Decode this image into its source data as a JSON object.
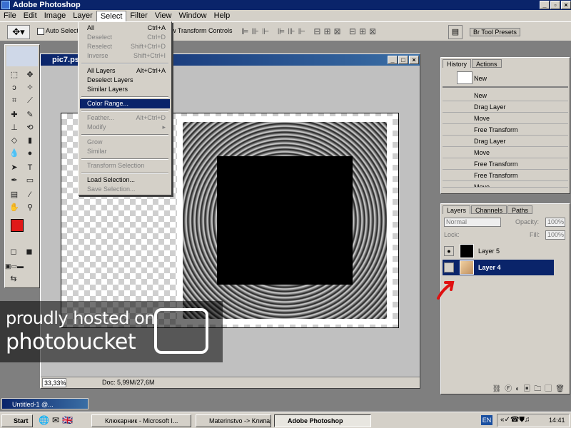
{
  "app": {
    "title": "Adobe Photoshop"
  },
  "menubar": [
    "File",
    "Edit",
    "Image",
    "Layer",
    "Select",
    "Filter",
    "View",
    "Window",
    "Help"
  ],
  "options": {
    "auto_select": "Auto Select L",
    "transform": "w Transform Controls",
    "tool_presets": "Tool Presets"
  },
  "document": {
    "title": "pic7.psd",
    "zoom": "33,33%",
    "doc_info": "Doc: 5,99M/27,6M"
  },
  "select_menu": [
    {
      "label": "All",
      "shortcut": "Ctrl+A",
      "enabled": true
    },
    {
      "label": "Deselect",
      "shortcut": "Ctrl+D",
      "enabled": false
    },
    {
      "label": "Reselect",
      "shortcut": "Shift+Ctrl+D",
      "enabled": false
    },
    {
      "label": "Inverse",
      "shortcut": "Shift+Ctrl+I",
      "enabled": false
    },
    {
      "label": "All Layers",
      "shortcut": "Alt+Ctrl+A",
      "enabled": true
    },
    {
      "label": "Deselect Layers",
      "shortcut": "",
      "enabled": true
    },
    {
      "label": "Similar Layers",
      "shortcut": "",
      "enabled": true
    },
    {
      "label": "Color Range...",
      "shortcut": "",
      "enabled": true,
      "highlighted": true
    },
    {
      "label": "Feather...",
      "shortcut": "Alt+Ctrl+D",
      "enabled": false
    },
    {
      "label": "Modify",
      "shortcut": "",
      "enabled": false
    },
    {
      "label": "Grow",
      "shortcut": "",
      "enabled": false
    },
    {
      "label": "Similar",
      "shortcut": "",
      "enabled": false
    },
    {
      "label": "Transform Selection",
      "shortcut": "",
      "enabled": false
    },
    {
      "label": "Load Selection...",
      "shortcut": "",
      "enabled": true
    },
    {
      "label": "Save Selection...",
      "shortcut": "",
      "enabled": false
    }
  ],
  "history": {
    "tabs": [
      "History",
      "Actions"
    ],
    "snapshot": "New",
    "items": [
      "New",
      "Drag Layer",
      "Move",
      "Free Transform",
      "Drag Layer",
      "Move",
      "Free Transform",
      "Free Transform",
      "Move"
    ]
  },
  "layers": {
    "tabs": [
      "Layers",
      "Channels",
      "Paths"
    ],
    "blend_mode": "Normal",
    "opacity_label": "Opacity:",
    "opacity": "100%",
    "lock_label": "Lock:",
    "fill_label": "Fill:",
    "fill": "100%",
    "items": [
      {
        "name": "Layer 5",
        "selected": false
      },
      {
        "name": "Layer 4",
        "selected": true
      }
    ]
  },
  "untitled_window": "Untitled-1 @...",
  "taskbar": {
    "start": "Start",
    "buttons": [
      {
        "label": "Клюкарник - Microsoft I...",
        "active": false
      },
      {
        "label": "Materinstvo -> Клипарт...",
        "active": false
      },
      {
        "label": "Adobe Photoshop",
        "active": true
      }
    ],
    "lang": "EN",
    "clock": "14:41"
  },
  "watermark": {
    "line1": "proudly hosted on",
    "line2": "photobucket"
  },
  "colors": {
    "foreground": "#e01818",
    "background": "#ffffff",
    "selection": "#0a246a",
    "arrow": "#e01010"
  }
}
